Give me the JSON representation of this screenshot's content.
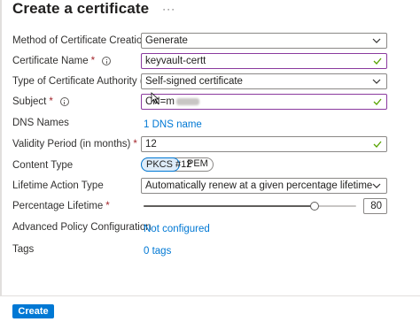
{
  "page": {
    "title": "Create a certificate",
    "more_label": "···"
  },
  "form": {
    "method": {
      "label": "Method of Certificate Creation",
      "value": "Generate",
      "icon": "chevron-down-icon"
    },
    "name": {
      "label": "Certificate Name",
      "required_mark": "*",
      "value": "keyvault-certt",
      "icon": "checkmark-icon"
    },
    "authority": {
      "label": "Type of Certificate Authority (CA)",
      "value": "Self-signed certificate",
      "icon": "chevron-down-icon"
    },
    "subject": {
      "label": "Subject",
      "required_mark": "*",
      "value": "CN=m",
      "icon": "checkmark-icon"
    },
    "dns": {
      "label": "DNS Names",
      "link": "1 DNS name"
    },
    "validity": {
      "label": "Validity Period (in months)",
      "required_mark": "*",
      "value": "12",
      "icon": "checkmark-icon"
    },
    "content_type": {
      "label": "Content Type",
      "options": [
        "PKCS #12",
        "PEM"
      ],
      "selected": "PKCS #12"
    },
    "lifetime_action": {
      "label": "Lifetime Action Type",
      "value": "Automatically renew at a given percentage lifetime",
      "icon": "chevron-down-icon"
    },
    "percentage": {
      "label": "Percentage Lifetime",
      "required_mark": "*",
      "value": "80",
      "min": 1,
      "max": 99,
      "level_percent": 80
    },
    "advanced": {
      "label": "Advanced Policy Configuration",
      "link": "Not configured"
    },
    "tags": {
      "label": "Tags",
      "link": "0 tags"
    }
  },
  "footer": {
    "create_label": "Create"
  },
  "colors": {
    "accent": "#0078d4",
    "valid_border": "#8a3a9e",
    "valid_check": "#57a300",
    "required": "#a4262c"
  }
}
